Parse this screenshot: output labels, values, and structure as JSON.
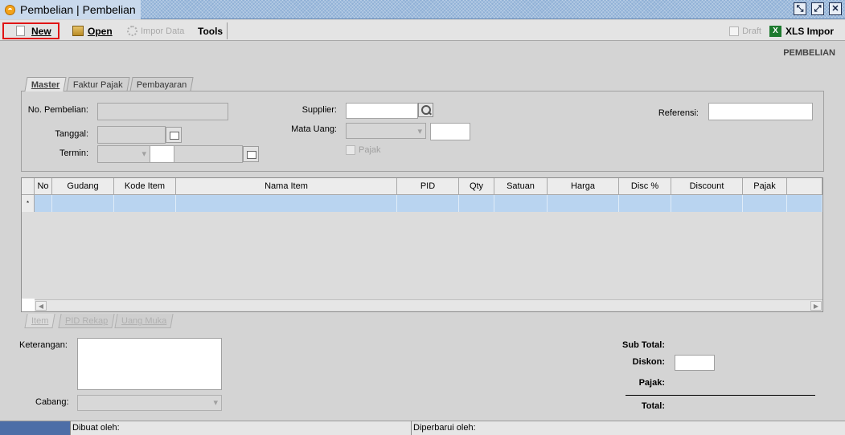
{
  "window": {
    "title": "Pembelian | Pembelian",
    "buttons": [
      "restore-down",
      "maximize",
      "close"
    ]
  },
  "toolbar": {
    "new_label": "New",
    "open_label": "Open",
    "impor_label": "Impor Data",
    "tools_label": "Tools",
    "draft_label": "Draft",
    "xls_label": "XLS Impor"
  },
  "page_label": "PEMBELIAN",
  "tabs": [
    "Master",
    "Faktur Pajak",
    "Pembayaran"
  ],
  "master": {
    "no_pembelian_label": "No. Pembelian:",
    "no_pembelian_value": "",
    "tanggal_label": "Tanggal:",
    "tanggal_value": "",
    "termin_label": "Termin:",
    "supplier_label": "Supplier:",
    "supplier_value": "",
    "mata_uang_label": "Mata Uang:",
    "mata_uang_value": "",
    "pajak_label": "Pajak",
    "referensi_label": "Referensi:",
    "referensi_value": ""
  },
  "grid": {
    "columns": [
      "No",
      "Gudang",
      "Kode Item",
      "Nama Item",
      "PID",
      "Qty",
      "Satuan",
      "Harga",
      "Disc %",
      "Discount",
      "Pajak"
    ],
    "new_row_marker": "*"
  },
  "bottom_tabs": [
    "Item",
    "PID Rekap",
    "Uang Muka"
  ],
  "footer": {
    "keterangan_label": "Keterangan:",
    "cabang_label": "Cabang:",
    "sub_total_label": "Sub Total:",
    "diskon_label": "Diskon:",
    "pajak_label": "Pajak:",
    "total_label": "Total:"
  },
  "statusbar": {
    "dibuat_label": "Dibuat oleh:",
    "diperbarui_label": "Diperbarui oleh:"
  },
  "colors": {
    "selected_row": "#b9d4f0",
    "highlight_border": "#e01515",
    "status_accent": "#4d6ea7"
  }
}
